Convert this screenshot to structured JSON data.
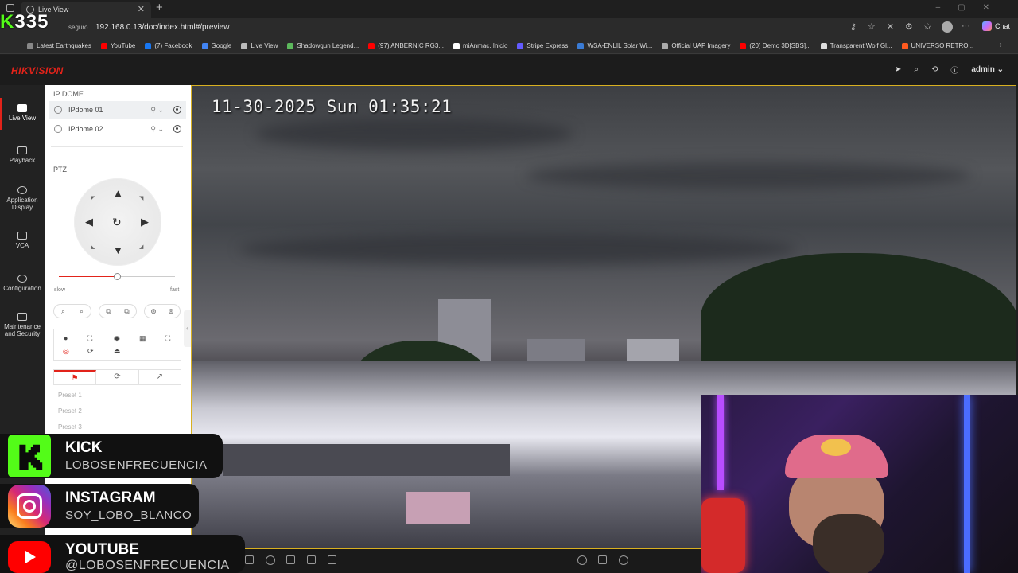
{
  "browser": {
    "tab_title": "Live View",
    "address_prefix": "seguro",
    "url": "192.168.0.13/doc/index.html#/preview",
    "chat_label": "Chat",
    "bookmarks": [
      {
        "label": "Latest Earthquakes",
        "color": "#888888"
      },
      {
        "label": "YouTube",
        "color": "#ff0000"
      },
      {
        "label": "(7) Facebook",
        "color": "#1877f2"
      },
      {
        "label": "Google",
        "color": "#4285f4"
      },
      {
        "label": "Live View",
        "color": "#bbbbbb"
      },
      {
        "label": "Shadowgun Legend...",
        "color": "#5cb85c"
      },
      {
        "label": "(97) ANBERNIC RG3...",
        "color": "#ff0000"
      },
      {
        "label": "miAnmac. Inicio",
        "color": "#ffffff"
      },
      {
        "label": "Stripe Express",
        "color": "#635bff"
      },
      {
        "label": "WSA-ENLIL Solar Wi...",
        "color": "#3a7bd5"
      },
      {
        "label": "Official UAP Imagery",
        "color": "#aaaaaa"
      },
      {
        "label": "(20) Demo 3D[SBS]...",
        "color": "#ff0000"
      },
      {
        "label": "Transparent Wolf Gl...",
        "color": "#dddddd"
      },
      {
        "label": "UNIVERSO RETRO...",
        "color": "#ff5a1f"
      }
    ]
  },
  "overlay_logo": {
    "k": "K",
    "num": "335"
  },
  "header": {
    "brand": "HIKVISION",
    "user": "admin"
  },
  "nav": [
    {
      "label": "Live View",
      "active": true
    },
    {
      "label": "Playback"
    },
    {
      "label": "Application Display"
    },
    {
      "label": "VCA"
    },
    {
      "label": "Configuration"
    },
    {
      "label": "Maintenance and Security"
    }
  ],
  "panel": {
    "group_title": "IP DOME",
    "cameras": [
      "IPdome 01",
      "IPdome 02"
    ],
    "ptz_title": "PTZ",
    "speed_slow": "slow",
    "speed_fast": "fast",
    "speed_level": 0.5,
    "presets": [
      "Preset 1",
      "Preset 2",
      "Preset 3"
    ]
  },
  "video": {
    "osd": "11-30-2025 Sun 01:35:21"
  },
  "socials": [
    {
      "name": "KICK",
      "handle": "LOBOSENFRECUENCIA",
      "color": "#53fc18"
    },
    {
      "name": "INSTAGRAM",
      "handle": "SOY_LOBO_BLANCO",
      "color": "#d62976"
    },
    {
      "name": "YOUTUBE",
      "handle": "@LOBOSENFRECUENCIA",
      "color": "#ff0000"
    }
  ]
}
